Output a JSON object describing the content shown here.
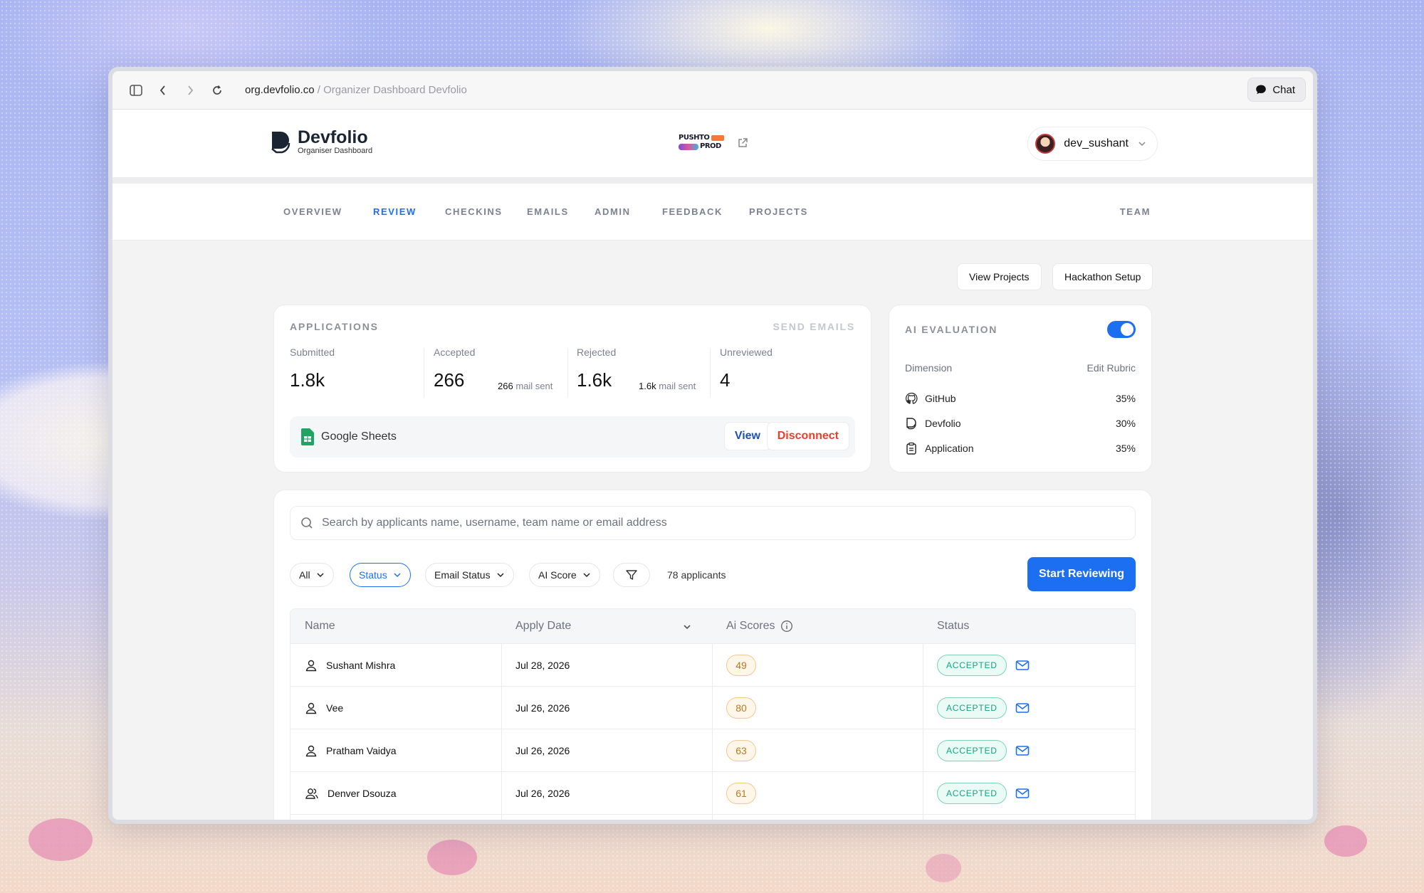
{
  "browser": {
    "url_host": "org.devfolio.co",
    "url_rest": " / Organizer Dashboard Devfolio",
    "chat_label": "Chat"
  },
  "header": {
    "logo_title": "Devfolio",
    "logo_subtitle": "Organiser Dashboard",
    "hackathon_logo_line1": "PUSHTO",
    "hackathon_logo_line2": "PROD",
    "username": "dev_sushant"
  },
  "nav": {
    "tabs": [
      {
        "label": "OVERVIEW"
      },
      {
        "label": "REVIEW",
        "active": true
      },
      {
        "label": "CHECKINS"
      },
      {
        "label": "EMAILS"
      },
      {
        "label": "ADMIN"
      },
      {
        "label": "FEEDBACK"
      },
      {
        "label": "PROJECTS"
      }
    ],
    "team_label": "TEAM"
  },
  "actions": {
    "view_projects": "View Projects",
    "hackathon_setup": "Hackathon Setup"
  },
  "applications": {
    "title": "APPLICATIONS",
    "send_emails": "SEND EMAILS",
    "stats": [
      {
        "label": "Submitted",
        "value": "1.8k"
      },
      {
        "label": "Accepted",
        "value": "266",
        "mail_count": "266",
        "mail_label": "mail sent"
      },
      {
        "label": "Rejected",
        "value": "1.6k",
        "mail_count": "1.6k",
        "mail_label": "mail sent"
      },
      {
        "label": "Unreviewed",
        "value": "4"
      }
    ],
    "sheets": {
      "label": "Google Sheets",
      "view": "View",
      "disconnect": "Disconnect"
    }
  },
  "ai_evaluation": {
    "title": "AI EVALUATION",
    "enabled": true,
    "dimension_header": "Dimension",
    "edit_rubric": "Edit Rubric",
    "dimensions": [
      {
        "name": "GitHub",
        "percent": "35%",
        "icon": "github-icon"
      },
      {
        "name": "Devfolio",
        "percent": "30%",
        "icon": "devfolio-icon"
      },
      {
        "name": "Application",
        "percent": "35%",
        "icon": "clipboard-icon"
      }
    ]
  },
  "search": {
    "placeholder": "Search by applicants name, username, team name or email address"
  },
  "filters": {
    "all": "All",
    "status": "Status",
    "email_status": "Email Status",
    "ai_score": "AI Score",
    "applicant_count": "78 applicants",
    "start_reviewing": "Start Reviewing"
  },
  "table": {
    "columns": [
      "Name",
      "Apply Date",
      "Ai Scores",
      "Status"
    ],
    "rows": [
      {
        "name": "Sushant Mishra",
        "date": "Jul 28, 2026",
        "score": "49",
        "status": "ACCEPTED",
        "type": "person"
      },
      {
        "name": "Vee",
        "date": "Jul 26, 2026",
        "score": "80",
        "status": "ACCEPTED",
        "type": "person"
      },
      {
        "name": "Pratham Vaidya",
        "date": "Jul 26, 2026",
        "score": "63",
        "status": "ACCEPTED",
        "type": "person"
      },
      {
        "name": "Denver Dsouza",
        "date": "Jul 26, 2026",
        "score": "61",
        "status": "ACCEPTED",
        "type": "team"
      }
    ]
  },
  "colors": {
    "accent": "#1d6ff2",
    "danger": "#e5402a",
    "accepted": "#14a37f",
    "score": "#b7791f"
  }
}
